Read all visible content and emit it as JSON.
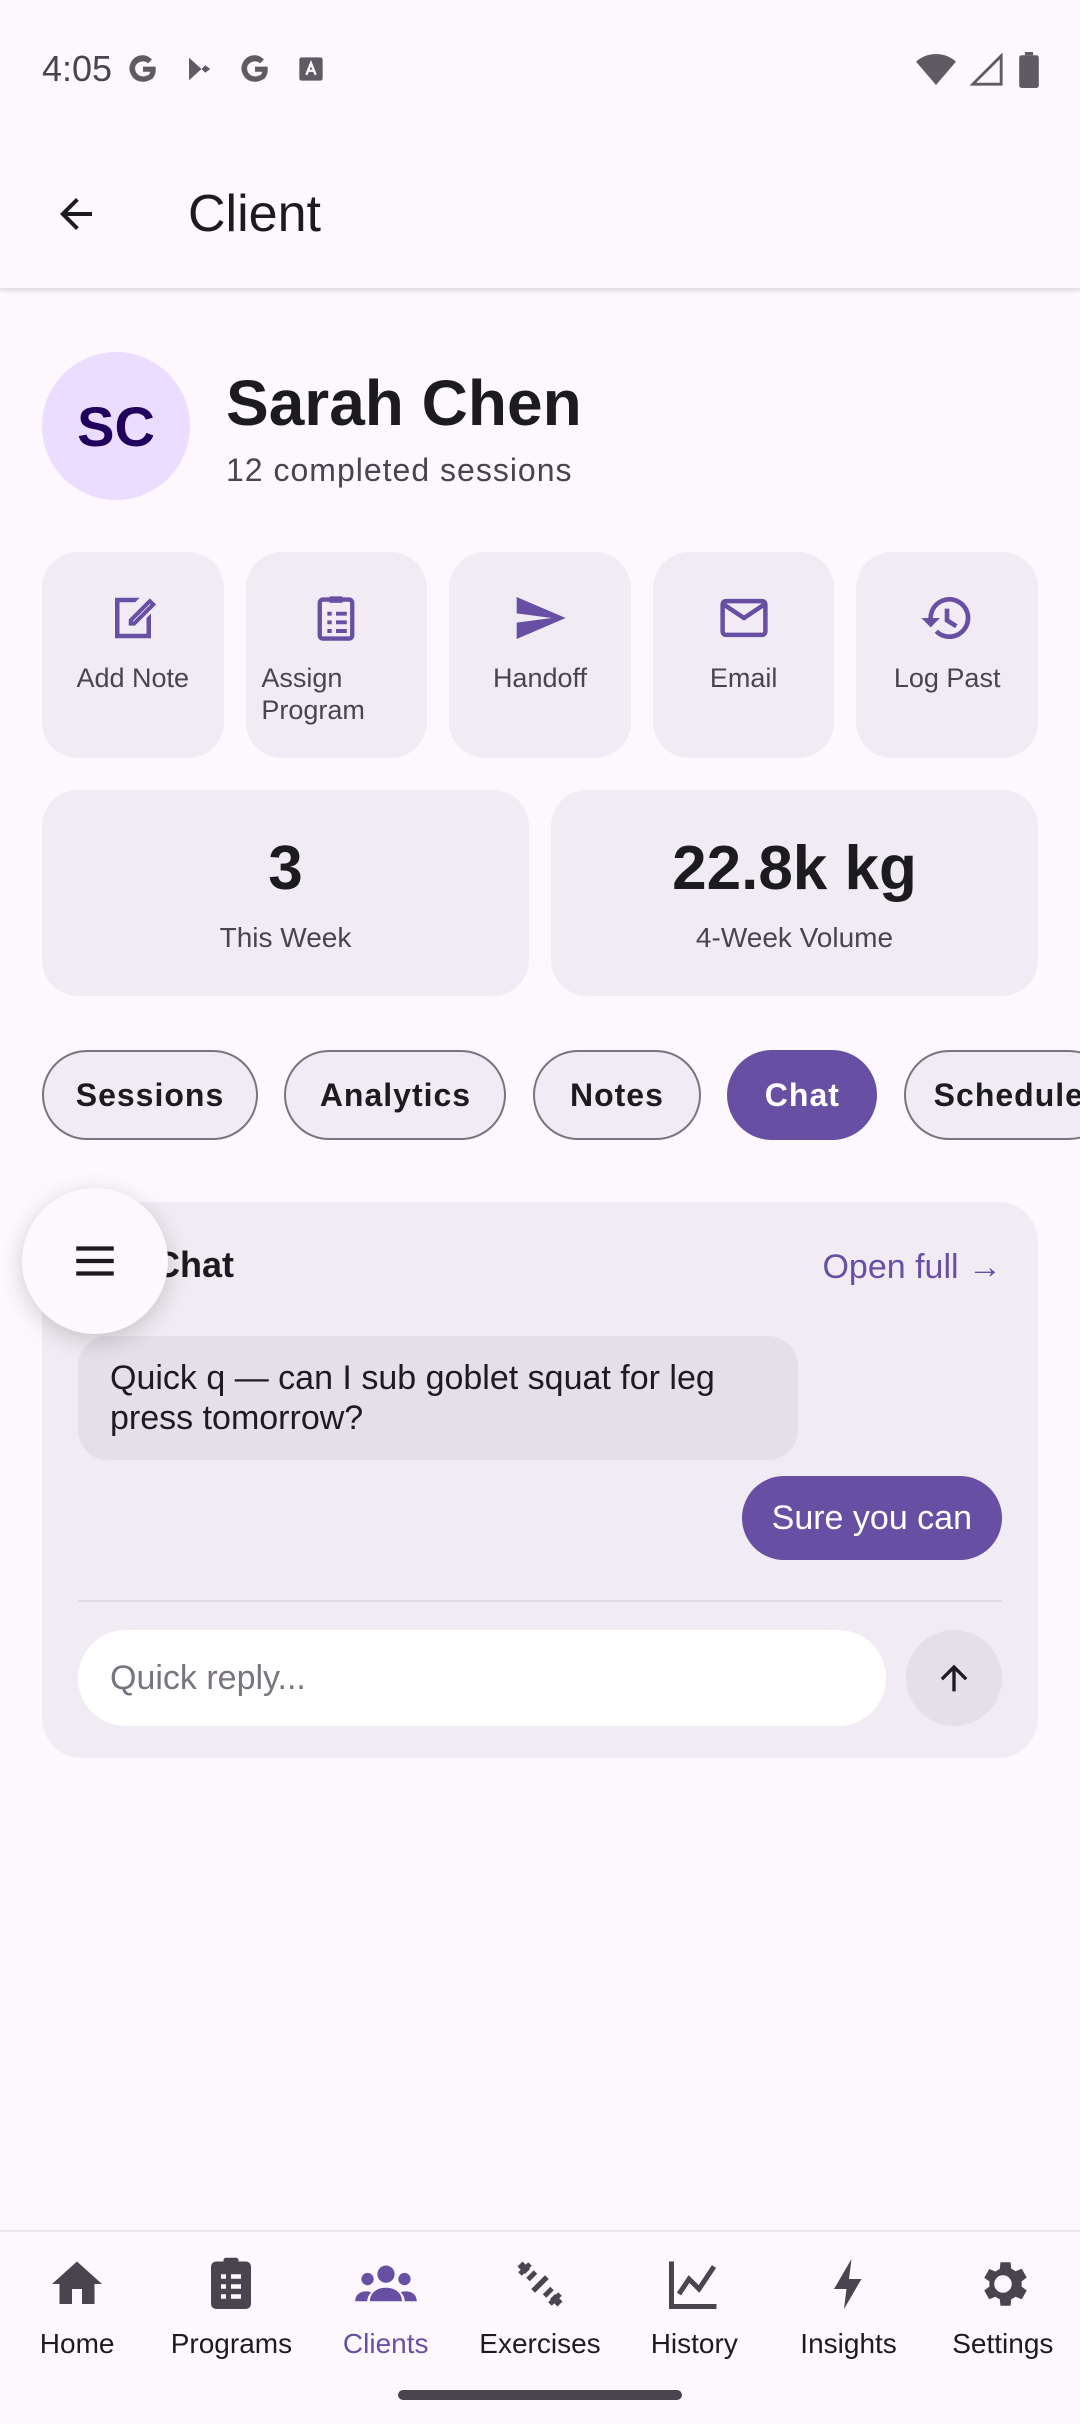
{
  "status_bar": {
    "time": "4:05"
  },
  "app_bar": {
    "title": "Client"
  },
  "client": {
    "initials": "SC",
    "name": "Sarah Chen",
    "subtitle": "12 completed sessions"
  },
  "actions": [
    {
      "label": "Add Note",
      "icon": "edit-note-icon"
    },
    {
      "label": "Assign Program",
      "icon": "clipboard-icon"
    },
    {
      "label": "Handoff",
      "icon": "send-icon"
    },
    {
      "label": "Email",
      "icon": "mail-icon"
    },
    {
      "label": "Log Past",
      "icon": "history-icon"
    }
  ],
  "stats": [
    {
      "value": "3",
      "label": "This Week"
    },
    {
      "value": "22.8k kg",
      "label": "4-Week Volume"
    }
  ],
  "tabs": [
    {
      "label": "Sessions",
      "active": false
    },
    {
      "label": "Analytics",
      "active": false
    },
    {
      "label": "Notes",
      "active": false
    },
    {
      "label": "Chat",
      "active": true
    },
    {
      "label": "Schedule",
      "active": false
    }
  ],
  "chat": {
    "title": "Chat",
    "open_full": "Open full →",
    "incoming_message": "Quick q — can I sub goblet squat for leg press tomorrow?",
    "outgoing_message": "Sure you can",
    "reply_placeholder": "Quick reply..."
  },
  "bottom_nav": [
    {
      "label": "Home",
      "icon": "home-icon",
      "active": false
    },
    {
      "label": "Programs",
      "icon": "clipboard-list-icon",
      "active": false
    },
    {
      "label": "Clients",
      "icon": "people-icon",
      "active": true
    },
    {
      "label": "Exercises",
      "icon": "dumbbell-icon",
      "active": false
    },
    {
      "label": "History",
      "icon": "chart-line-icon",
      "active": false
    },
    {
      "label": "Insights",
      "icon": "bolt-icon",
      "active": false
    },
    {
      "label": "Settings",
      "icon": "gear-icon",
      "active": false
    }
  ],
  "colors": {
    "primary": "#6750a4",
    "surface": "#fdf8fd",
    "card": "#f1ecf3",
    "avatar_bg": "#eaddff"
  }
}
